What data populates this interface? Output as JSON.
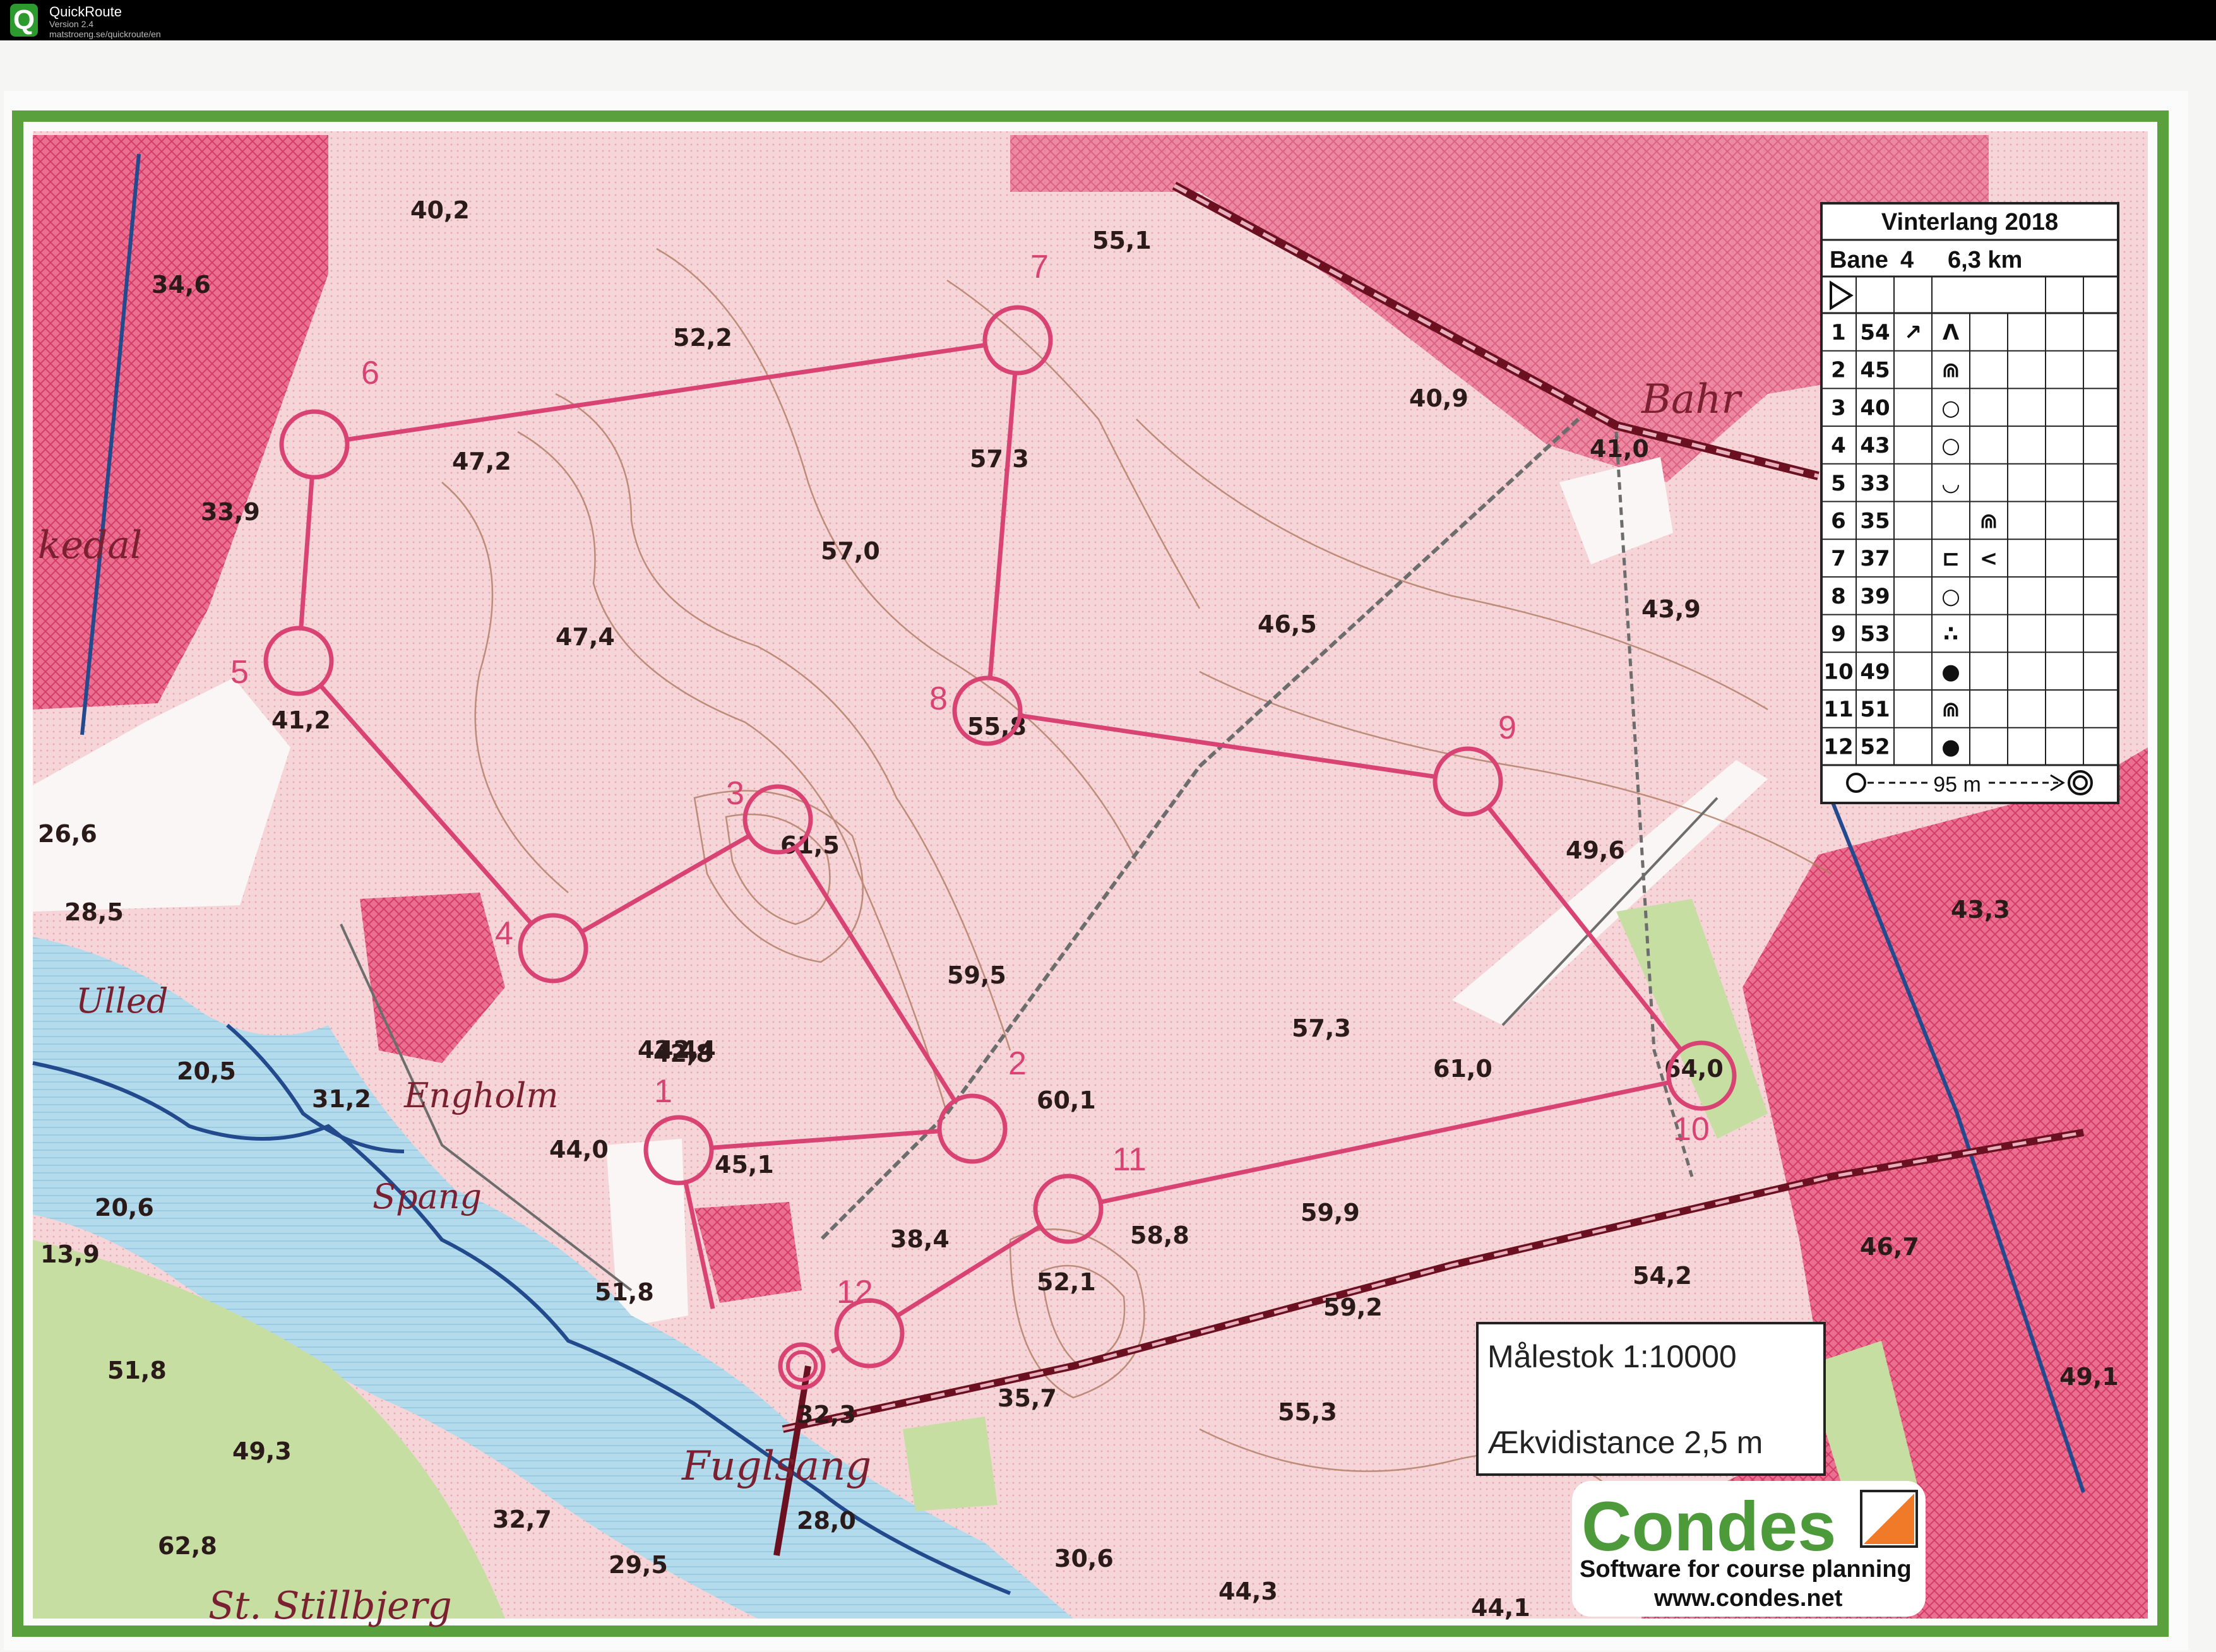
{
  "app": {
    "title": "QuickRoute",
    "version": "Version 2.4",
    "url": "matstroeng.se/quickroute/en"
  },
  "colors": {
    "border_green": "#5aa03c",
    "paper": "#f4d3d6",
    "private_area": "#e5587c",
    "water": "#b6dcec",
    "meadow": "#c9dfa5",
    "course": "#d94374",
    "contour": "#b07a62",
    "road": "#6d6d6d",
    "railway": "#b01030",
    "stream": "#234a8c"
  },
  "map": {
    "place_names": [
      "Bahr",
      "Engholm",
      "Spang",
      "Fuglsang",
      "St. Stillbjerg",
      "Ulled",
      "kedal"
    ],
    "spot_heights": [
      "40,2",
      "34,6",
      "33,9",
      "52,2",
      "47,2",
      "47,4",
      "57,3",
      "57,0",
      "55,1",
      "40,9",
      "41,0",
      "46,5",
      "43,9",
      "41,2",
      "26,6",
      "28,5",
      "61,5",
      "55,8",
      "49,6",
      "59,5",
      "42,4",
      "42,4",
      "44,0",
      "45,1",
      "60,1",
      "57,3",
      "61,0",
      "64,0",
      "43,3",
      "38,4",
      "52,1",
      "58,8",
      "59,9",
      "59,2",
      "54,2",
      "46,7",
      "20,6",
      "13,9",
      "51,8",
      "49,3",
      "62,8",
      "32,7",
      "29,5",
      "28,0",
      "32,3",
      "35,7",
      "55,3",
      "30,6",
      "44,3",
      "44,1",
      "49,1",
      "31,2",
      "20,5",
      "51,8",
      "42,8"
    ]
  },
  "course": {
    "controls": [
      {
        "number": "1"
      },
      {
        "number": "2"
      },
      {
        "number": "3"
      },
      {
        "number": "4"
      },
      {
        "number": "5"
      },
      {
        "number": "6"
      },
      {
        "number": "7"
      },
      {
        "number": "8"
      },
      {
        "number": "9"
      },
      {
        "number": "10"
      },
      {
        "number": "11"
      },
      {
        "number": "12"
      }
    ]
  },
  "legend": {
    "event": "Vinterlang 2018",
    "course": "Bane",
    "course_number": "4",
    "length": "6,3 km",
    "start_symbol": "start-triangle-icon",
    "rows": [
      {
        "seq": "1",
        "code": "54",
        "s1": "↗",
        "s2": "ⴷ",
        "s3": ""
      },
      {
        "seq": "2",
        "code": "45",
        "s1": "",
        "s2": "⋒",
        "s3": ""
      },
      {
        "seq": "3",
        "code": "40",
        "s1": "",
        "s2": "○",
        "s3": ""
      },
      {
        "seq": "4",
        "code": "43",
        "s1": "",
        "s2": "○",
        "s3": ""
      },
      {
        "seq": "5",
        "code": "33",
        "s1": "",
        "s2": "◡",
        "s3": ""
      },
      {
        "seq": "6",
        "code": "35",
        "s1": "",
        "s2": "",
        "s3": "⋒"
      },
      {
        "seq": "7",
        "code": "37",
        "s1": "",
        "s2": "⊏",
        "s3": "<"
      },
      {
        "seq": "8",
        "code": "39",
        "s1": "",
        "s2": "○",
        "s3": ""
      },
      {
        "seq": "9",
        "code": "53",
        "s1": "",
        "s2": "∴",
        "s3": ""
      },
      {
        "seq": "10",
        "code": "49",
        "s1": "",
        "s2": "●",
        "s3": ""
      },
      {
        "seq": "11",
        "code": "51",
        "s1": "",
        "s2": "⋒",
        "s3": ""
      },
      {
        "seq": "12",
        "code": "52",
        "s1": "",
        "s2": "●",
        "s3": ""
      }
    ],
    "finish_text": "95 m"
  },
  "scale_box": {
    "scale": "Målestok 1:10000",
    "contour": "Ækvidistance 2,5 m"
  },
  "condes": {
    "name": "Condes",
    "tagline": "Software for course planning",
    "url": "www.condes.net"
  }
}
